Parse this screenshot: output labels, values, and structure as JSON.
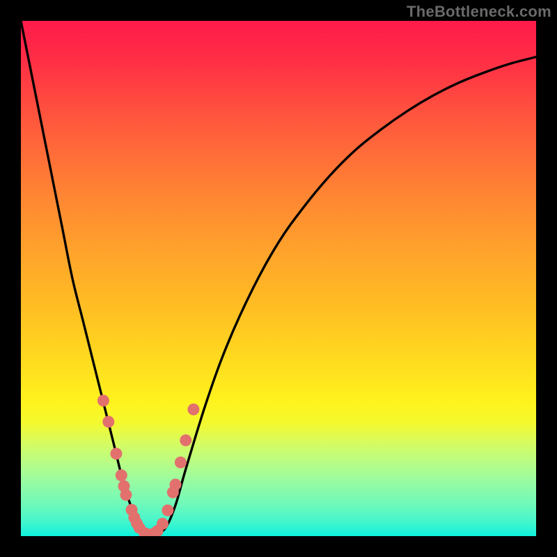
{
  "watermark": {
    "text": "TheBottleneck.com"
  },
  "colors": {
    "background": "#000000",
    "curve": "#000000",
    "marker": "#e2716e",
    "gradient_top": "#ff1a4a",
    "gradient_bottom": "#0df1df"
  },
  "chart_data": {
    "type": "line",
    "title": "",
    "xlabel": "",
    "ylabel": "",
    "xlim": [
      0,
      100
    ],
    "ylim": [
      0,
      100
    ],
    "series": [
      {
        "name": "bottleneck-curve",
        "x": [
          0,
          2,
          4,
          6,
          8,
          10,
          12,
          14,
          16,
          18,
          20,
          22,
          23,
          24,
          25,
          26,
          28,
          30,
          32,
          36,
          40,
          45,
          50,
          55,
          60,
          65,
          70,
          75,
          80,
          85,
          90,
          95,
          100
        ],
        "y": [
          100,
          90,
          80,
          70,
          60,
          50,
          42,
          34,
          26,
          18,
          10,
          4,
          1.5,
          0.5,
          0.3,
          0.5,
          1.5,
          6,
          13,
          26,
          37,
          48,
          57,
          64,
          70,
          75,
          79,
          82.5,
          85.5,
          88,
          90,
          91.7,
          93
        ]
      }
    ],
    "markers": {
      "name": "sample-points",
      "x": [
        16.0,
        17.0,
        18.5,
        19.5,
        20.0,
        20.4,
        21.5,
        22.0,
        22.5,
        23.0,
        24.0,
        25.0,
        26.0,
        26.5,
        27.5,
        28.5,
        29.5,
        30.0,
        31.0,
        32.0,
        33.5
      ],
      "y": [
        26.3,
        22.2,
        16.0,
        11.8,
        9.7,
        8.0,
        5.1,
        3.6,
        2.5,
        1.6,
        0.6,
        0.3,
        0.6,
        1.0,
        2.4,
        5.0,
        8.5,
        10.0,
        14.3,
        18.6,
        24.6
      ]
    }
  }
}
